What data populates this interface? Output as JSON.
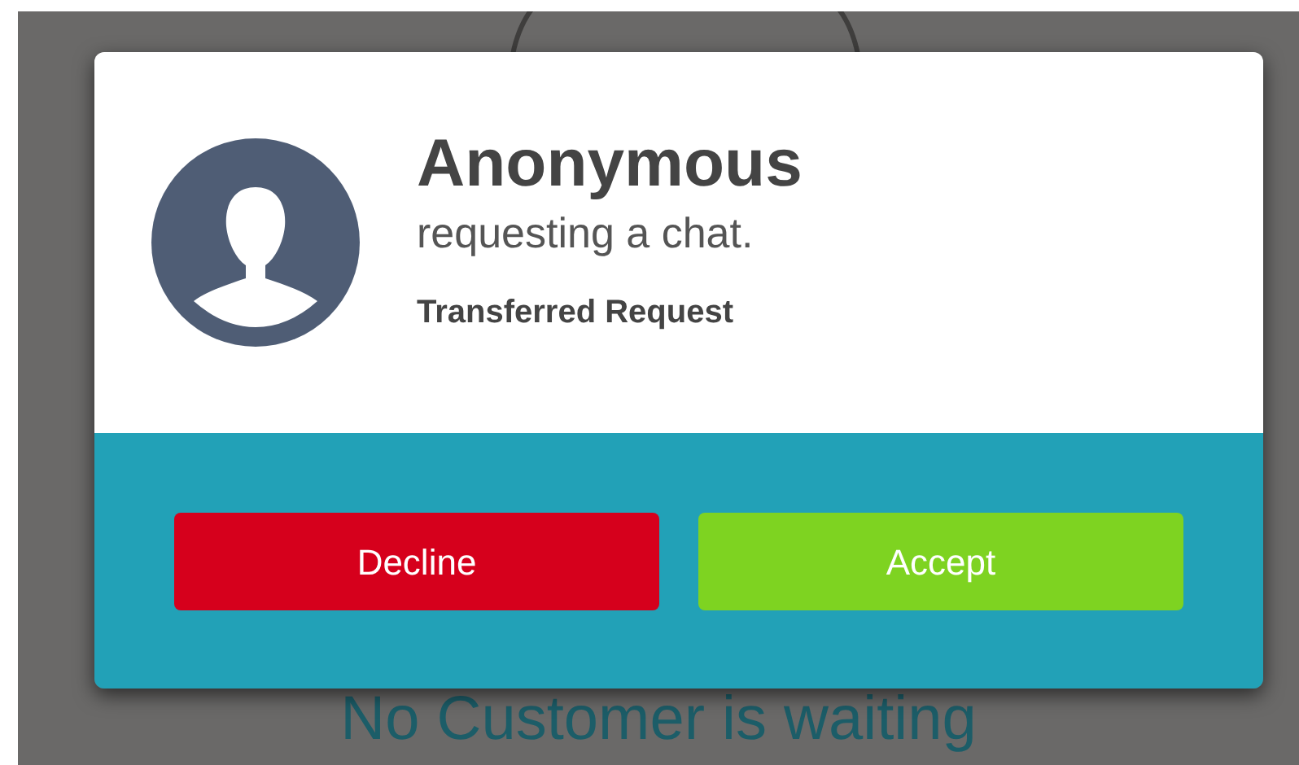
{
  "background": {
    "message": "No Customer is waiting"
  },
  "dialog": {
    "name": "Anonymous",
    "subtitle": "requesting a chat.",
    "note": "Transferred Request",
    "buttons": [
      {
        "label": "Decline",
        "kind": "decline"
      },
      {
        "label": "Accept",
        "kind": "accept"
      }
    ]
  }
}
